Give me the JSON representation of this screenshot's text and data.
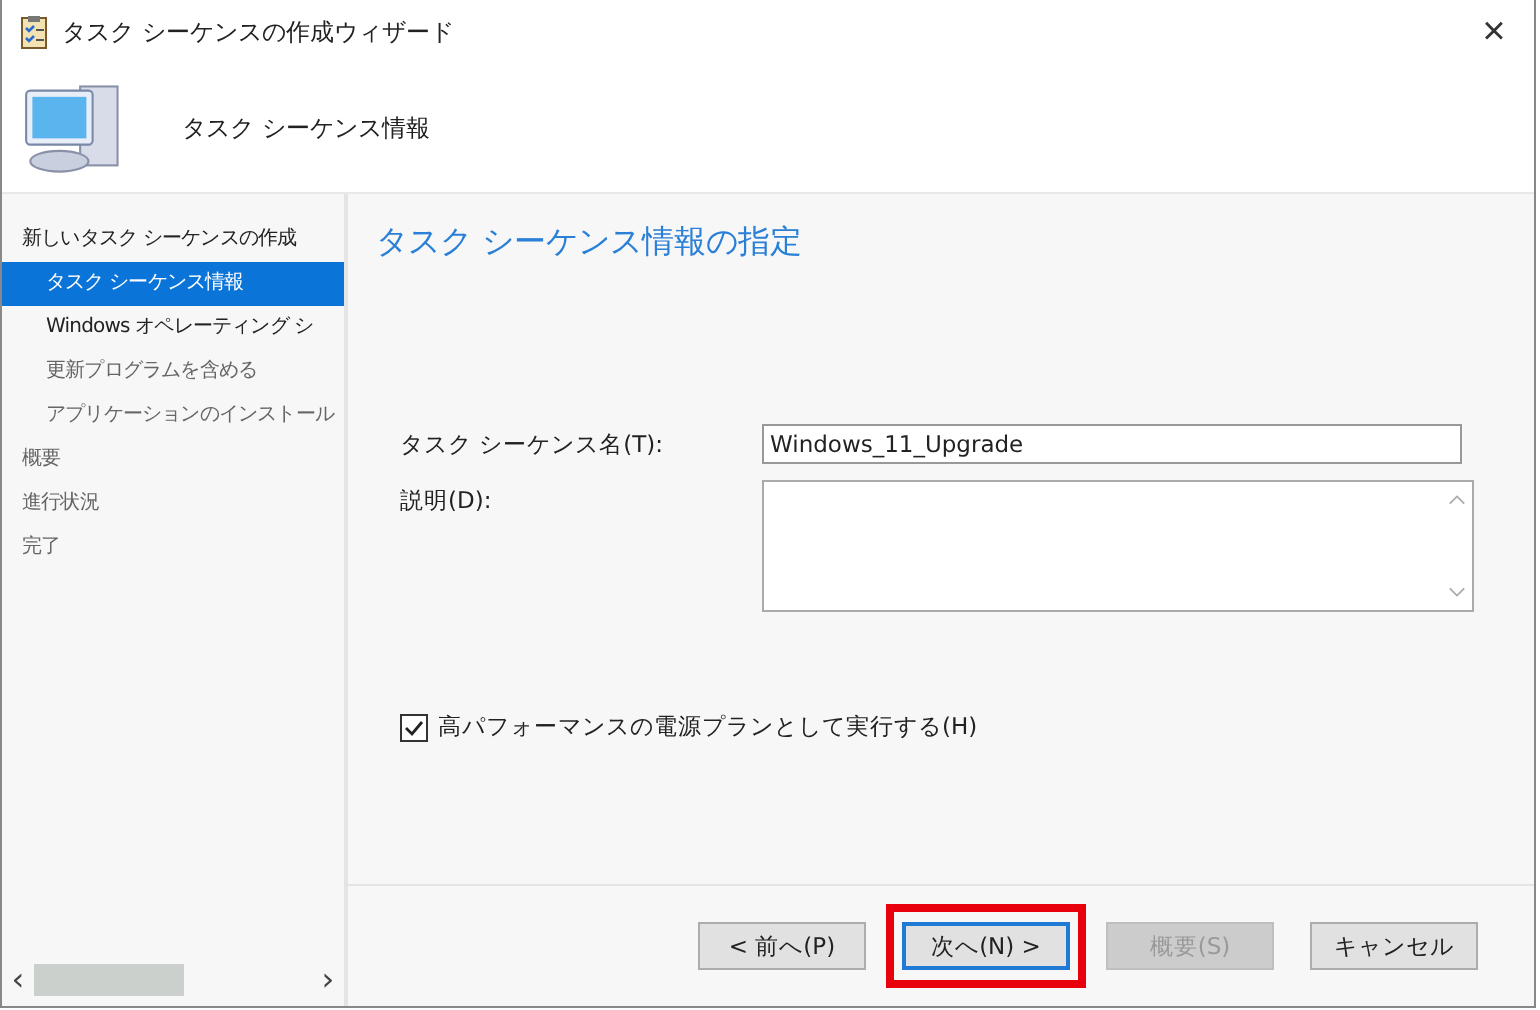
{
  "window": {
    "title": "タスク シーケンスの作成ウィザード",
    "close": "×"
  },
  "header": {
    "title": "タスク シーケンス情報"
  },
  "nav": {
    "items": [
      {
        "label": "新しいタスク シーケンスの作成",
        "selected": false,
        "disabled": false,
        "children": [
          {
            "label": "タスク シーケンス情報",
            "selected": true,
            "disabled": false
          },
          {
            "label": "Windows オペレーティング シ",
            "selected": false,
            "disabled": false
          },
          {
            "label": "更新プログラムを含める",
            "selected": false,
            "disabled": true
          },
          {
            "label": "アプリケーションのインストール",
            "selected": false,
            "disabled": true
          }
        ]
      },
      {
        "label": "概要",
        "selected": false,
        "disabled": true
      },
      {
        "label": "進行状況",
        "selected": false,
        "disabled": true
      },
      {
        "label": "完了",
        "selected": false,
        "disabled": true
      }
    ],
    "scroll_left": "‹",
    "scroll_right": "›"
  },
  "page": {
    "heading": "タスク シーケンス情報の指定",
    "name_label": "タスク シーケンス名(T):",
    "name_value": "Windows_11_Upgrade",
    "description_label": "説明(D):",
    "checkbox": {
      "label": "高パフォーマンスの電源プランとして実行する(H)",
      "checked": true
    }
  },
  "buttons": [
    {
      "label": "< 前へ(P)",
      "disabled": false,
      "focused": false,
      "highlighted": false
    },
    {
      "label": "次へ(N) >",
      "disabled": false,
      "focused": true,
      "highlighted": true
    },
    {
      "label": "概要(S)",
      "disabled": true,
      "focused": false,
      "highlighted": false
    },
    {
      "label": "キャンセル",
      "disabled": false,
      "focused": false,
      "highlighted": false
    }
  ]
}
